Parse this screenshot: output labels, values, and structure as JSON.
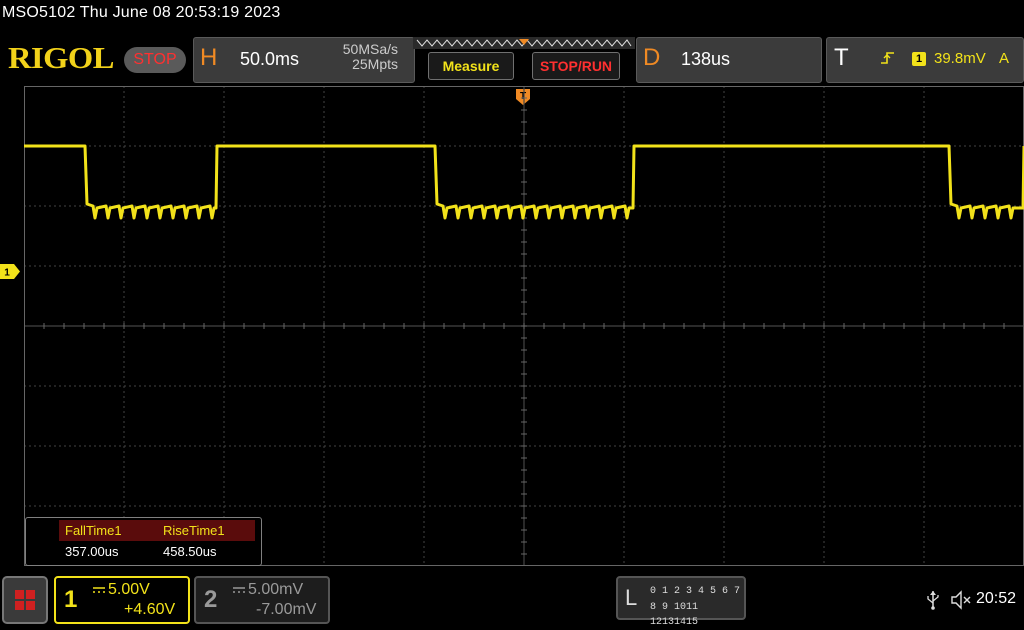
{
  "header": {
    "model_datetime": "MSO5102  Thu June 08 20:53:19 2023",
    "logo": "RIGOL",
    "run_state": "STOP"
  },
  "horizontal": {
    "letter": "H",
    "timebase": "50.0ms",
    "sample_rate": "50MSa/s",
    "memory_depth": "25Mpts"
  },
  "buttons": {
    "measure": "Measure",
    "stop_run": "STOP/RUN"
  },
  "delay": {
    "letter": "D",
    "value": "138us"
  },
  "trigger": {
    "letter": "T",
    "edge_icon": "rising-edge-icon",
    "source": "1",
    "level": "39.8mV",
    "mode": "A",
    "marker_label": "T"
  },
  "measurements": [
    {
      "name": "FallTime1",
      "value": "357.00us"
    },
    {
      "name": "RiseTime1",
      "value": "458.50us"
    }
  ],
  "channels": {
    "ch1": {
      "number": "1",
      "scale": "5.00V",
      "offset": "+4.60V",
      "color": "#f2e21a",
      "marker": "1"
    },
    "ch2": {
      "number": "2",
      "scale": "5.00mV",
      "offset": "-7.00mV",
      "color": "#9a9a9a"
    }
  },
  "logic": {
    "letter": "L",
    "bits_row1": "0 1 2 3  4 5 6 7",
    "bits_row2": "8 9 1011 12131415"
  },
  "status": {
    "usb_icon": "usb-icon",
    "sound_icon": "speaker-muted-icon",
    "time": "20:52"
  },
  "colors": {
    "trace": "#f2e21a",
    "accent_orange": "#f08a24",
    "stop_red": "#ff3030",
    "grid": "#4a4a4a"
  }
}
